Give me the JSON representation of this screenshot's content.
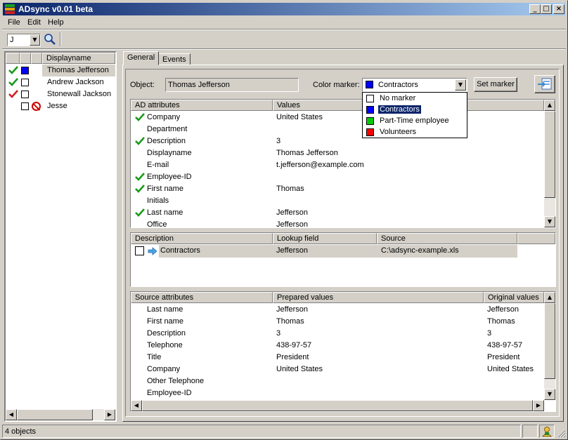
{
  "window": {
    "title": "ADsync v0.01 beta"
  },
  "titlebuttons": {
    "minimize": "_",
    "maximize": "□",
    "close": "×"
  },
  "menu": [
    "File",
    "Edit",
    "Help"
  ],
  "toolbar": {
    "combo_value": "J"
  },
  "users": {
    "header": "Displayname",
    "rows": [
      {
        "check": "green",
        "marker": "blue",
        "name": "Thomas Jefferson",
        "selected": true
      },
      {
        "check": "green",
        "marker": "none",
        "name": "Andrew Jackson",
        "selected": false
      },
      {
        "check": "red",
        "marker": "none",
        "name": "Stonewall Jackson",
        "selected": false
      },
      {
        "check": "none",
        "marker": "none",
        "name": "Jesse",
        "selected": false,
        "stop": true
      }
    ]
  },
  "tabs": [
    "General",
    "Events"
  ],
  "general": {
    "object_label": "Object:",
    "object_value": "Thomas Jefferson",
    "color_marker_label": "Color marker:",
    "color_marker_value": "Contractors",
    "set_marker": "Set marker",
    "dropdown": [
      {
        "label": "No marker",
        "color": "#ffffff"
      },
      {
        "label": "Contractors",
        "color": "#0000ff",
        "selected": true
      },
      {
        "label": "Part-Time employee",
        "color": "#00cc00"
      },
      {
        "label": "Volunteers",
        "color": "#ff0000"
      }
    ]
  },
  "ad": {
    "headers": [
      "AD attributes",
      "Values"
    ],
    "rows": [
      {
        "ok": true,
        "attr": "Company",
        "value": "United States"
      },
      {
        "ok": false,
        "attr": "Department",
        "value": ""
      },
      {
        "ok": true,
        "attr": "Description",
        "value": "3"
      },
      {
        "ok": false,
        "attr": "Displayname",
        "value": "Thomas Jefferson"
      },
      {
        "ok": false,
        "attr": "E-mail",
        "value": "t.jefferson@example.com"
      },
      {
        "ok": true,
        "attr": "Employee-ID",
        "value": ""
      },
      {
        "ok": true,
        "attr": "First name",
        "value": "Thomas"
      },
      {
        "ok": false,
        "attr": "Initials",
        "value": ""
      },
      {
        "ok": true,
        "attr": "Last name",
        "value": "Jefferson"
      },
      {
        "ok": false,
        "attr": "Office",
        "value": "Jefferson"
      }
    ]
  },
  "lookup": {
    "headers": [
      "Description",
      "Lookup field",
      "Source"
    ],
    "rows": [
      {
        "desc": "Contractors",
        "field": "Jefferson",
        "source": "C:\\adsync-example.xls"
      }
    ]
  },
  "source": {
    "headers": [
      "Source attributes",
      "Prepared values",
      "Original values"
    ],
    "rows": [
      {
        "attr": "Last name",
        "prepared": "Jefferson",
        "original": "Jefferson"
      },
      {
        "attr": "First name",
        "prepared": "Thomas",
        "original": "Thomas"
      },
      {
        "attr": "Description",
        "prepared": "3",
        "original": "3"
      },
      {
        "attr": "Telephone",
        "prepared": "438-97-57",
        "original": "438-97-57"
      },
      {
        "attr": "Title",
        "prepared": "President",
        "original": "President"
      },
      {
        "attr": "Company",
        "prepared": "United States",
        "original": "United States"
      },
      {
        "attr": "Other Telephone",
        "prepared": "",
        "original": ""
      },
      {
        "attr": "Employee-ID",
        "prepared": "",
        "original": ""
      }
    ]
  },
  "status": {
    "text": "4 objects"
  }
}
